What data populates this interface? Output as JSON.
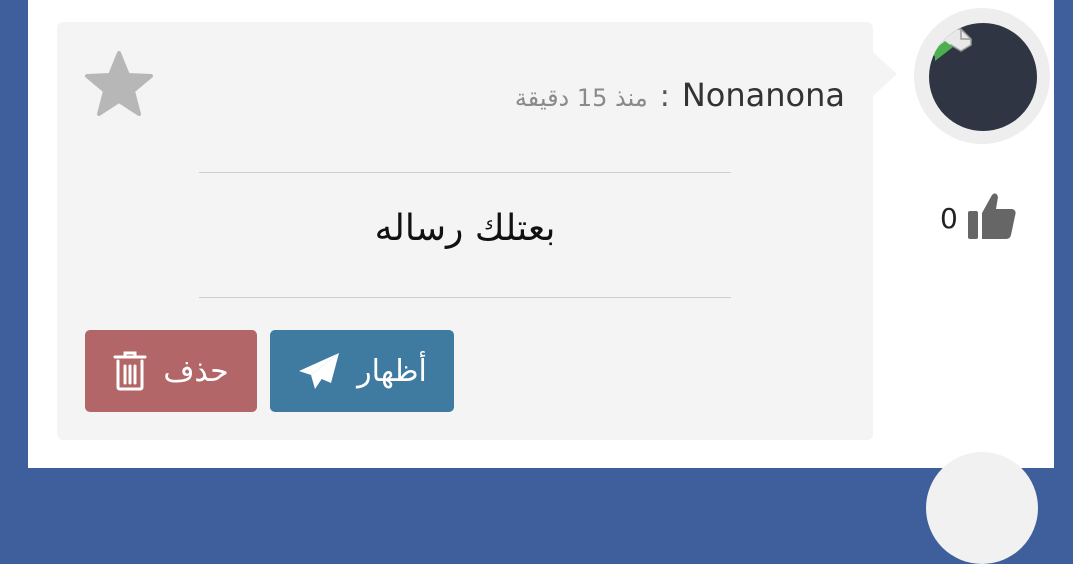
{
  "message_card": {
    "author": "Nonanona",
    "separator": ":",
    "time": "منذ 15 دقيقة",
    "body": "بعتلك رساله",
    "show_button_label": "أظهار",
    "delete_button_label": "حذف",
    "icons": {
      "favorite": "star-icon",
      "show": "paper-plane-icon",
      "delete": "trash-icon",
      "like": "thumbs-up-icon",
      "avatar": "broken-image-icon"
    }
  },
  "likes": {
    "count": "0"
  },
  "colors": {
    "page_background": "#3f5f9c",
    "card_background": "#f4f4f4",
    "show_button": "#3f7aa0",
    "delete_button": "#b26667",
    "avatar_background": "#2f3542",
    "star": "#b7b7b7"
  }
}
